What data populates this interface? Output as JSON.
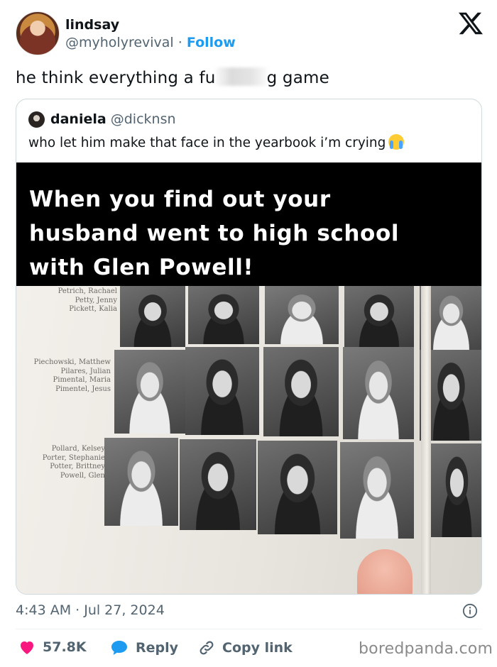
{
  "author": {
    "display_name": "lindsay",
    "handle": "@myholyrevival",
    "separator": "·",
    "follow_label": "Follow"
  },
  "tweet": {
    "text_before": "he think everything a fu",
    "text_after": "g game"
  },
  "quoted": {
    "display_name": "daniela",
    "handle": "@dicknsn",
    "text": "who let him make that face in the yearbook i’m crying",
    "media": {
      "caption_lines": [
        "When you find out your",
        "husband went to high school",
        "with Glen Powell!"
      ],
      "name_groups": [
        [
          "Petrich, Rachael",
          "Petty, Jenny",
          "Pickett, Kalia"
        ],
        [
          "Piechowski, Matthew",
          "Pilares, Julian",
          "Pimental, Maria",
          "Pimentel, Jesus"
        ],
        [
          "Pollard, Kelsey",
          "Porter, Stephanie",
          "Potter, Brittney",
          "Powell, Glen"
        ]
      ]
    }
  },
  "meta": {
    "timestamp": "4:43 AM · Jul 27, 2024"
  },
  "actions": {
    "likes": "57.8K",
    "reply_label": "Reply",
    "copy_link_label": "Copy link"
  },
  "watermark": "boredpanda.com",
  "colors": {
    "accent": "#1d9bf0",
    "like": "#f91880",
    "muted": "#536471",
    "text": "#0f1419"
  },
  "icons": [
    "x-logo-icon",
    "crying-emoji-icon",
    "info-icon",
    "heart-icon",
    "reply-bubble-icon",
    "link-icon"
  ]
}
